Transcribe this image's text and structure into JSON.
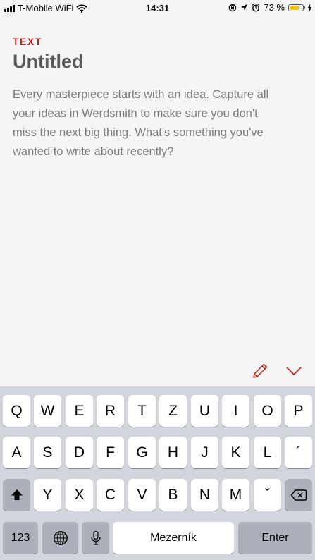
{
  "status_bar": {
    "carrier": "T-Mobile WiFi",
    "time": "14:31",
    "battery_percent": "73 %",
    "battery_level": 0.73,
    "icons": [
      "signal-icon",
      "wifi-icon",
      "rotation-lock-icon",
      "location-icon",
      "alarm-icon",
      "battery-icon",
      "charging-icon"
    ]
  },
  "editor": {
    "kind_label": "TEXT",
    "title": "Untitled",
    "placeholder_lines": [
      "Every masterpiece starts with an idea. Capture all",
      "your ideas in Werdsmith to make sure you don't",
      "miss the next big thing. What's something you've",
      "wanted to write about recently?"
    ]
  },
  "toolbar": {
    "icons": [
      "pencil-icon",
      "chevron-down-icon"
    ],
    "accent_color": "#b5231f"
  },
  "keyboard": {
    "row1": [
      "Q",
      "W",
      "E",
      "R",
      "T",
      "Z",
      "U",
      "I",
      "O",
      "P"
    ],
    "row2": [
      "A",
      "S",
      "D",
      "F",
      "G",
      "H",
      "J",
      "K",
      "L",
      "´"
    ],
    "row3": [
      "Y",
      "X",
      "C",
      "V",
      "B",
      "N",
      "M",
      "ˇ"
    ],
    "numbers_label": "123",
    "space_label": "Mezerník",
    "return_label": "Enter"
  }
}
